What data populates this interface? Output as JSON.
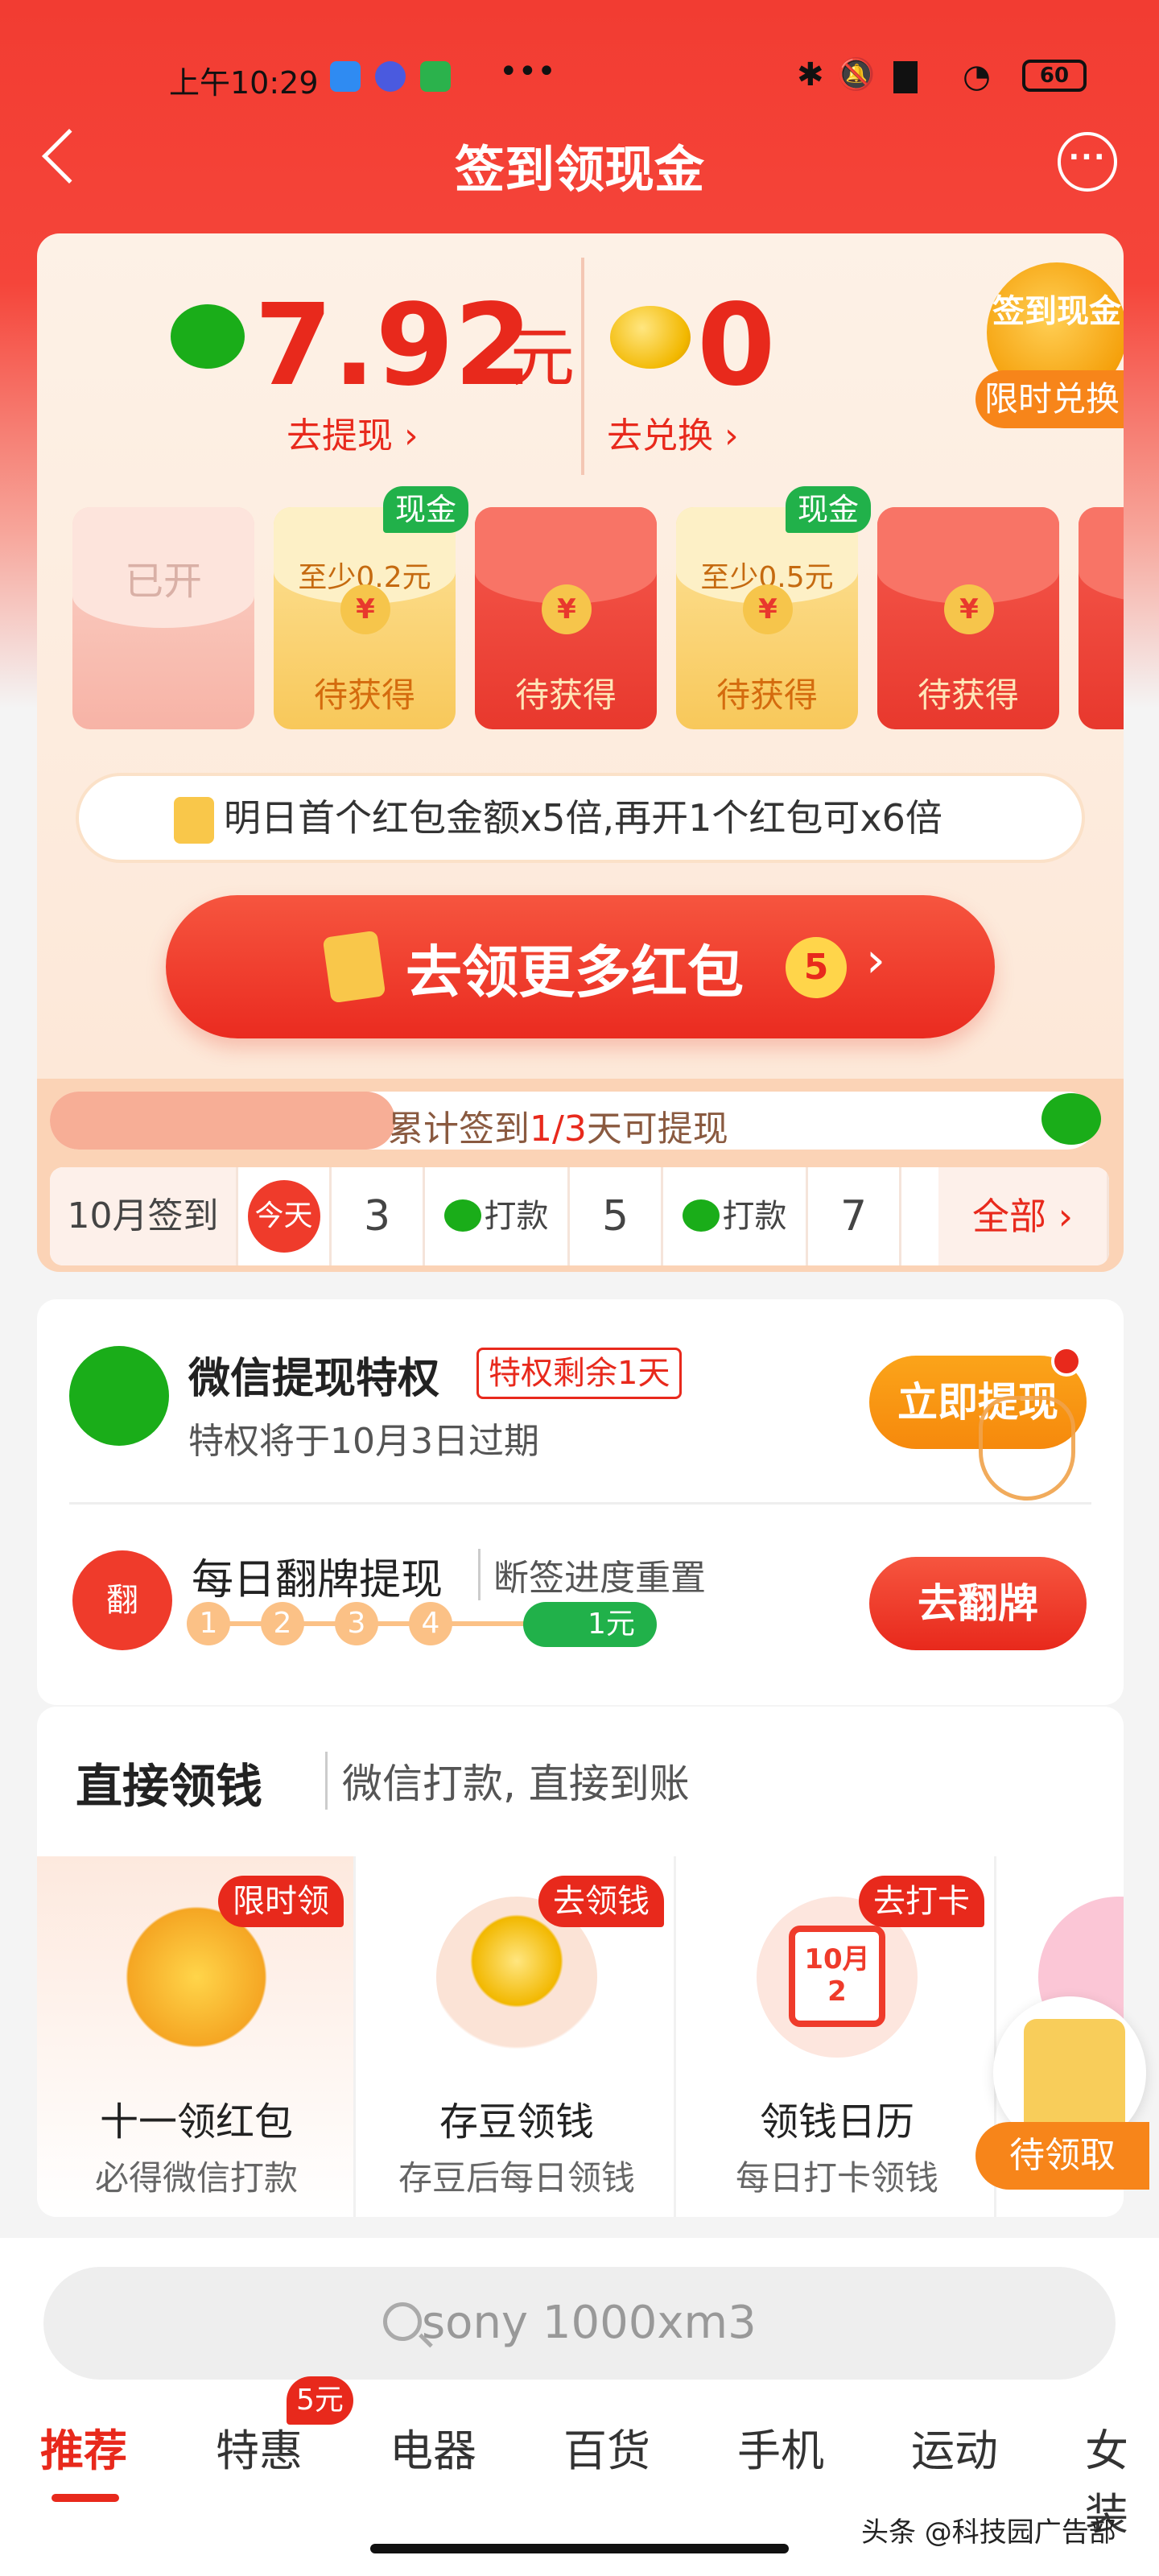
{
  "status": {
    "time": "上午10:29",
    "battery": "60"
  },
  "nav": {
    "title": "签到领现金",
    "more": "···"
  },
  "balance": {
    "cash_amount": "7.92",
    "cash_unit": "元",
    "cash_link": "去提现 ›",
    "beans": "0",
    "beans_link": "去兑换 ›",
    "coin_text": "签到现金",
    "coin_tag": "限时兑换"
  },
  "envelopes": [
    {
      "state": "opened",
      "label": "已开"
    },
    {
      "state": "gold",
      "tag": "现金",
      "sub": "至少0.2元",
      "label": "待获得"
    },
    {
      "state": "red",
      "label": "待获得"
    },
    {
      "state": "gold",
      "tag": "现金",
      "sub": "至少0.5元",
      "label": "待获得"
    },
    {
      "state": "red",
      "label": "待获得"
    }
  ],
  "tip": {
    "text": "明日首个红包金额x5倍,再开1个红包可x6倍"
  },
  "main_button": {
    "label": "去领更多红包",
    "count": "5",
    "arrow": "›"
  },
  "progress": {
    "prefix": "累计签到",
    "fraction": "1/3",
    "suffix": "天可提现",
    "fill": 0.33
  },
  "days": {
    "title": "10月签到",
    "today": "今天",
    "d3": "3",
    "pay": "打款",
    "d5": "5",
    "d7": "7",
    "all": "全部 ›"
  },
  "privilege": {
    "title": "微信提现特权",
    "badge": "特权剩余1天",
    "sub": "特权将于10月3日过期",
    "button": "立即提现"
  },
  "flip": {
    "title": "每日翻牌提现",
    "sub": "断签进度重置",
    "icon": "翻",
    "steps": [
      "1",
      "2",
      "3",
      "4"
    ],
    "reward": "1元",
    "button": "去翻牌"
  },
  "direct": {
    "title": "直接领钱",
    "subtitle": "微信打款, 直接到账",
    "tiles": [
      {
        "tag": "限时领",
        "name": "十一领红包",
        "desc": "必得微信打款"
      },
      {
        "tag": "去领钱",
        "name": "存豆领钱",
        "desc": "存豆后每日领钱"
      },
      {
        "tag": "去打卡",
        "name": "领钱日历",
        "desc": "每日打卡领钱",
        "cal": "10月 2"
      }
    ]
  },
  "float": {
    "label": "待领取"
  },
  "search": {
    "placeholder": "sony 1000xm3"
  },
  "tabs": {
    "items": [
      "推荐",
      "特惠",
      "电器",
      "百货",
      "手机",
      "运动",
      "女装"
    ],
    "badge": "5元"
  },
  "watermark": "头条 @科技园广告部",
  "colors": {
    "primary": "#e8291c",
    "wechat": "#1aad19",
    "gold": "#f6c54b"
  }
}
